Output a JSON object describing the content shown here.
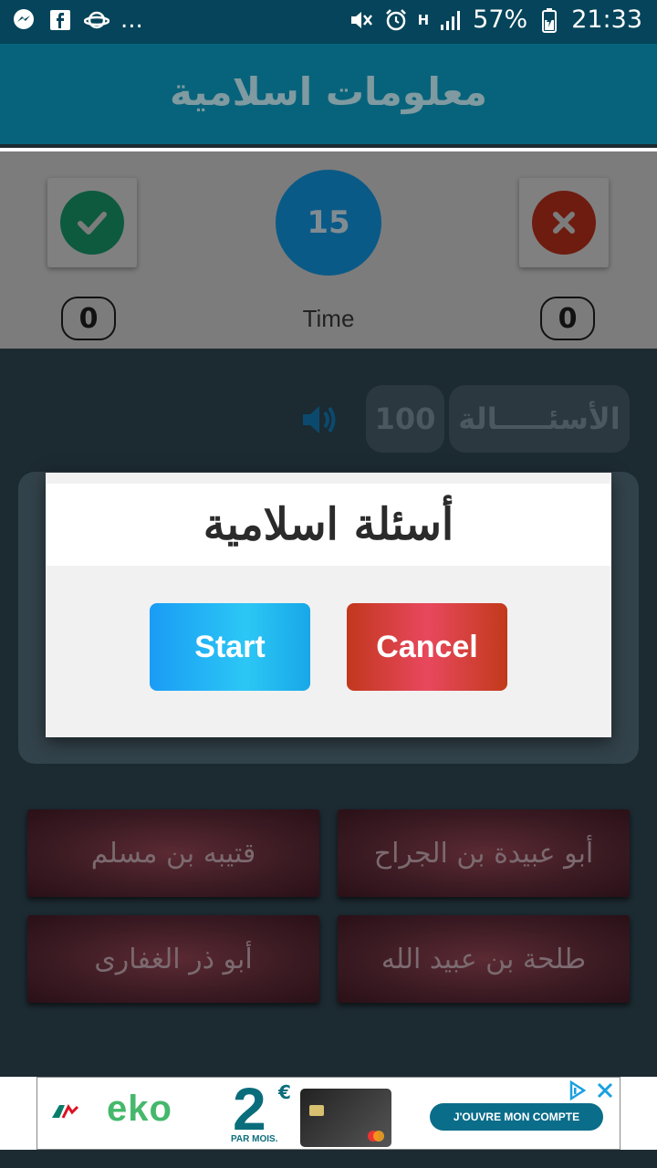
{
  "status_bar": {
    "battery": "57%",
    "time": "21:33",
    "network": "H",
    "overflow": "..."
  },
  "app": {
    "title": "معلومات اسلامية"
  },
  "score": {
    "correct_count": "0",
    "wrong_count": "0",
    "timer_value": "15",
    "timer_label": "Time"
  },
  "question_bar": {
    "count": "100",
    "label": "الأسئـــــالة"
  },
  "answers": [
    {
      "label": "أبو عبيدة بن الجراح"
    },
    {
      "label": "قتيبه بن مسلم"
    },
    {
      "label": "طلحة بن عبيد الله"
    },
    {
      "label": "أبو ذر الغفارى"
    }
  ],
  "dialog": {
    "title": "أسئلة اسلامية",
    "start_label": "Start",
    "cancel_label": "Cancel"
  },
  "ad": {
    "brand": "eko",
    "price": "2",
    "price_currency": "€",
    "price_period": "PAR MOIS.",
    "cta": "J'OUVRE MON COMPTE"
  },
  "colors": {
    "accent_start": "#1a9cf5",
    "accent_cancel": "#d8402e",
    "app_bar": "#07637b"
  }
}
